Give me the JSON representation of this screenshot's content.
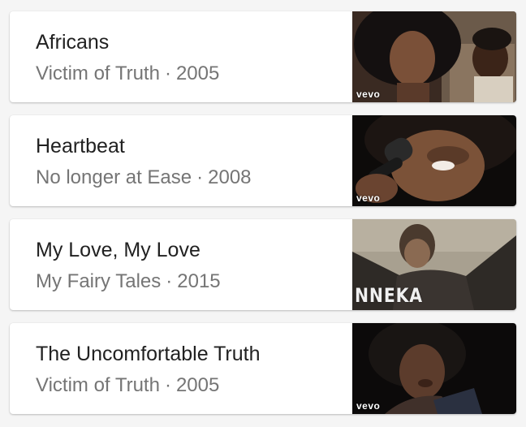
{
  "results": [
    {
      "title": "Africans",
      "album": "Victim of Truth",
      "separator": "·",
      "year": "2005",
      "thumbnail": {
        "badge": "vevo"
      }
    },
    {
      "title": "Heartbeat",
      "album": "No longer at Ease",
      "separator": "·",
      "year": "2008",
      "thumbnail": {
        "badge": "vevo"
      }
    },
    {
      "title": "My Love, My Love",
      "album": "My Fairy Tales",
      "separator": "·",
      "year": "2015",
      "thumbnail": {
        "badge": "NNEKA"
      }
    },
    {
      "title": "The Uncomfortable Truth",
      "album": "Victim of Truth",
      "separator": "·",
      "year": "2005",
      "thumbnail": {
        "badge": "vevo"
      }
    }
  ],
  "colors": {
    "background": "#f5f5f5",
    "card": "#ffffff",
    "title_text": "#212121",
    "subtitle_text": "#757575"
  }
}
